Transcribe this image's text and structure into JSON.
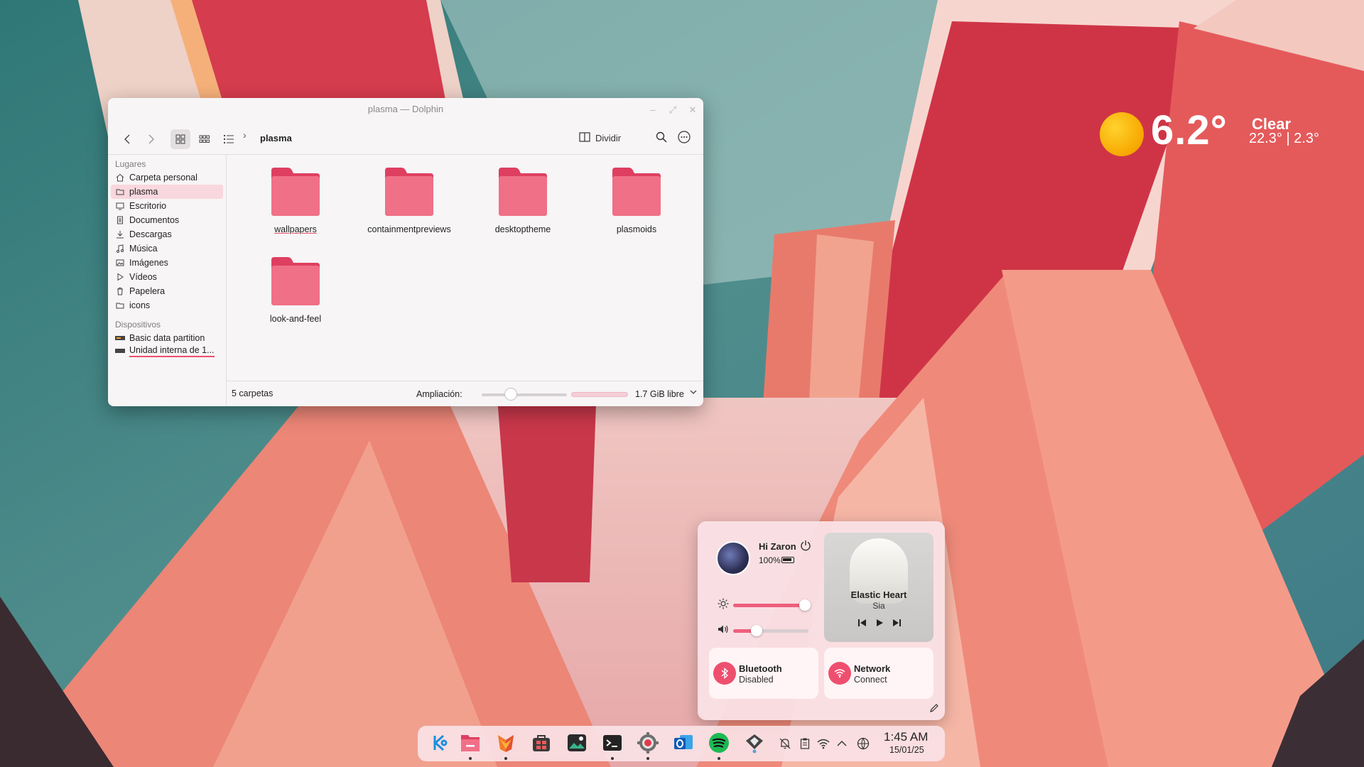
{
  "weather": {
    "temperature": "6.2°",
    "condition": "Clear",
    "range": "22.3° | 2.3°",
    "icon": "sun-icon"
  },
  "dolphin": {
    "title": "plasma — Dolphin",
    "breadcrumb": "plasma",
    "split_label": "Dividir",
    "sidebar": {
      "places_header": "Lugares",
      "places": [
        {
          "label": "Carpeta personal",
          "icon": "home-icon"
        },
        {
          "label": "plasma",
          "icon": "folder-icon"
        },
        {
          "label": "Escritorio",
          "icon": "desktop-icon"
        },
        {
          "label": "Documentos",
          "icon": "document-icon"
        },
        {
          "label": "Descargas",
          "icon": "download-icon"
        },
        {
          "label": "Música",
          "icon": "music-icon"
        },
        {
          "label": "Imágenes",
          "icon": "image-icon"
        },
        {
          "label": "Vídeos",
          "icon": "video-icon"
        },
        {
          "label": "Papelera",
          "icon": "trash-icon"
        },
        {
          "label": "icons",
          "icon": "folder-icon"
        }
      ],
      "devices_header": "Dispositivos",
      "devices": [
        {
          "label": "Basic data partition",
          "icon": "drive-icon"
        },
        {
          "label": "Unidad interna de 1...",
          "icon": "drive-icon"
        }
      ]
    },
    "folders": [
      {
        "name": "wallpapers"
      },
      {
        "name": "containmentpreviews"
      },
      {
        "name": "desktoptheme"
      },
      {
        "name": "plasmoids"
      },
      {
        "name": "look-and-feel"
      }
    ],
    "status": {
      "count": "5 carpetas",
      "zoom_label": "Ampliación:",
      "zoom_level": 0.3,
      "free_space": "1.7 GiB libre"
    },
    "accent": "#ee4f6f"
  },
  "quick_panel": {
    "greeting": "Hi Zaron",
    "battery": "100%",
    "brightness": 0.95,
    "volume": 0.31,
    "media": {
      "title": "Elastic Heart",
      "artist": "Sia"
    },
    "tiles": [
      {
        "name": "Bluetooth",
        "status": "Disabled",
        "icon": "bluetooth-icon"
      },
      {
        "name": "Network",
        "status": "Connect",
        "icon": "wifi-icon"
      }
    ]
  },
  "dock": {
    "apps": [
      {
        "name": "kde-launcher-icon",
        "running": false
      },
      {
        "name": "dolphin-icon",
        "running": true
      },
      {
        "name": "firefox-icon",
        "running": true
      },
      {
        "name": "discover-icon",
        "running": false
      },
      {
        "name": "image-viewer-icon",
        "running": false
      },
      {
        "name": "terminal-icon",
        "running": true
      },
      {
        "name": "settings-icon",
        "running": true
      },
      {
        "name": "outlook-icon",
        "running": false
      },
      {
        "name": "spotify-icon",
        "running": true
      },
      {
        "name": "kde-connect-icon",
        "running": false
      }
    ],
    "tray": [
      "notifications-icon",
      "clipboard-icon",
      "wifi-icon",
      "expand-icon",
      "network-globe-icon"
    ],
    "time": "1:45 AM",
    "date": "15/01/25"
  }
}
